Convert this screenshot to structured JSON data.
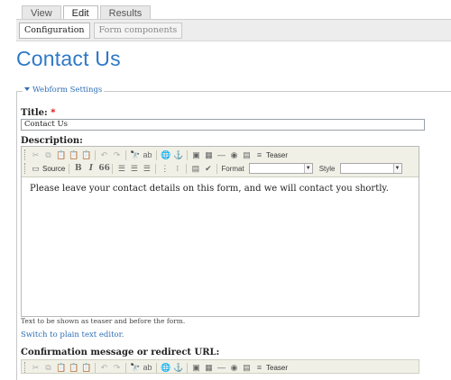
{
  "tabs_primary": [
    {
      "label": "View",
      "active": false
    },
    {
      "label": "Edit",
      "active": true
    },
    {
      "label": "Results",
      "active": false
    }
  ],
  "tabs_secondary": [
    {
      "label": "Configuration",
      "active": true
    },
    {
      "label": "Form components",
      "active": false
    }
  ],
  "page_title": "Contact Us",
  "fieldset": {
    "legend": "Webform Settings"
  },
  "title_field": {
    "label": "Title:",
    "required_marker": "*",
    "value": "Contact Us"
  },
  "description": {
    "label": "Description:",
    "content": "Please leave your contact details on this form, and we will contact you shortly.",
    "help": "Text to be shown as teaser and before the form.",
    "switch_link": "Switch to plain text editor."
  },
  "toolbar": {
    "teaser_label": "Teaser",
    "source_label": "Source",
    "bold_label": "B",
    "italic_label": "I",
    "blockquote_label": "66",
    "format_label": "Format",
    "style_label": "Style",
    "icons_row1": [
      "cut-icon",
      "copy-icon",
      "paste-icon",
      "paste-text-icon",
      "paste-word-icon",
      "undo-icon",
      "redo-icon",
      "find-icon",
      "replace-icon",
      "link-icon",
      "unlink-icon",
      "image-icon",
      "table-icon",
      "horizontal-rule-icon",
      "flash-icon",
      "media-icon",
      "teaser-break-icon"
    ],
    "icons_row2": [
      "source-icon",
      "bold-icon",
      "italic-icon",
      "blockquote-icon",
      "align-left-icon",
      "align-center-icon",
      "align-right-icon",
      "numbered-list-icon",
      "bulleted-list-icon",
      "paste-as-text-icon",
      "spellcheck-icon"
    ]
  },
  "confirmation": {
    "label": "Confirmation message or redirect URL:"
  },
  "colors": {
    "title": "#2f79c7",
    "link": "#2f6fb5",
    "required": "#dd0000",
    "toolbar_bg": "#f0f0e6"
  }
}
